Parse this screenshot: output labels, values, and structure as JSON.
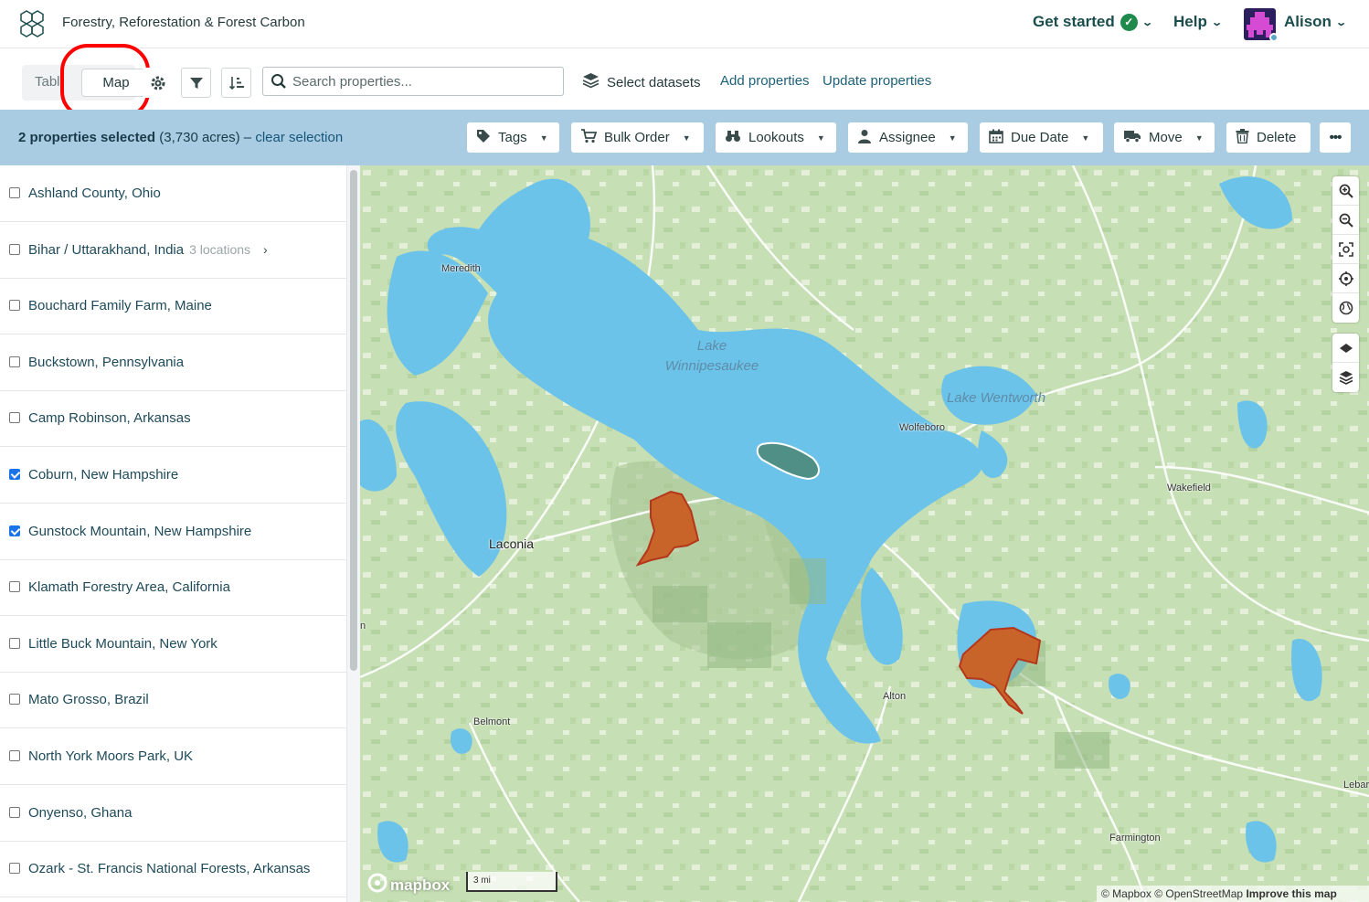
{
  "header": {
    "app_title": "Forestry, Reforestation & Forest Carbon",
    "get_started": "Get started",
    "help": "Help",
    "user_name": "Alison"
  },
  "toolbar": {
    "view_table": "Table",
    "view_map": "Map",
    "search_placeholder": "Search properties...",
    "select_datasets": "Select datasets",
    "add_properties": "Add properties",
    "update_properties": "Update properties"
  },
  "selection": {
    "count_text": "2 properties selected",
    "acres_text": "(3,730 acres)",
    "separator": "–",
    "clear_label": "clear selection",
    "buttons": [
      {
        "label": "Tags",
        "icon": "tag-icon"
      },
      {
        "label": "Bulk Order",
        "icon": "cart-icon"
      },
      {
        "label": "Lookouts",
        "icon": "binoculars-icon"
      },
      {
        "label": "Assignee",
        "icon": "person-icon"
      },
      {
        "label": "Due Date",
        "icon": "calendar-icon"
      },
      {
        "label": "Move",
        "icon": "truck-icon"
      },
      {
        "label": "Delete",
        "icon": "trash-icon"
      }
    ],
    "more_label": "•••"
  },
  "properties": [
    {
      "name": "Ashland County, Ohio",
      "checked": false
    },
    {
      "name": "Bihar / Uttarakhand, India",
      "sub": "3 locations",
      "checked": false
    },
    {
      "name": "Bouchard Family Farm, Maine",
      "checked": false
    },
    {
      "name": "Buckstown, Pennsylvania",
      "checked": false
    },
    {
      "name": "Camp Robinson, Arkansas",
      "checked": false
    },
    {
      "name": "Coburn, New Hampshire",
      "checked": true
    },
    {
      "name": "Gunstock Mountain, New Hampshire",
      "checked": true
    },
    {
      "name": "Klamath Forestry Area, California",
      "checked": false
    },
    {
      "name": "Little Buck Mountain, New York",
      "checked": false
    },
    {
      "name": "Mato Grosso, Brazil",
      "checked": false
    },
    {
      "name": "North York Moors Park, UK",
      "checked": false
    },
    {
      "name": "Onyenso, Ghana",
      "checked": false
    },
    {
      "name": "Ozark - St. Francis National Forests, Arkansas",
      "checked": false
    }
  ],
  "map": {
    "places": {
      "meredith": "Meredith",
      "wolfeboro": "Wolfeboro",
      "wakefield": "Wakefield",
      "laconia": "Laconia",
      "alton": "Alton",
      "belmont": "Belmont",
      "farmington": "Farmington",
      "lebanon_cut": "Lebar",
      "edge_n": "n"
    },
    "water": {
      "lake_w_line1": "Lake",
      "lake_w_line2": "Winnipesaukee",
      "lake_wentworth": "Lake Wentworth"
    },
    "scale": "3 mi",
    "logo": "mapbox",
    "attribution": "© Mapbox © OpenStreetMap",
    "improve": "Improve this map",
    "colors": {
      "land": "#c8e0b8",
      "water": "#6cc3ea",
      "property": "#c8642a",
      "selected_outline": "#b5361a"
    }
  }
}
